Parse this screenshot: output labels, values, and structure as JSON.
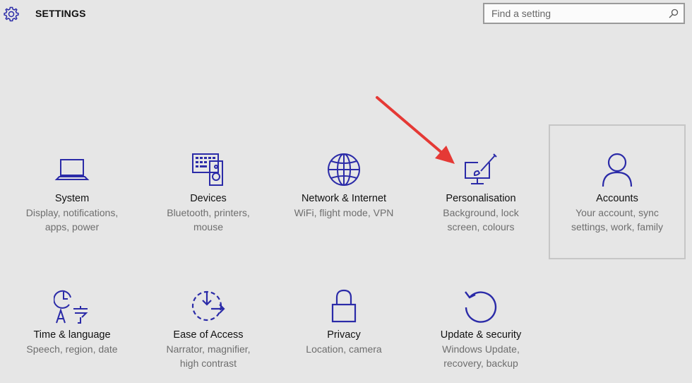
{
  "header": {
    "title": "SETTINGS",
    "search_placeholder": "Find a setting",
    "search_value": ""
  },
  "tiles": [
    {
      "name": "System",
      "desc1": "Display, notifications,",
      "desc2": "apps, power",
      "icon": "laptop-icon"
    },
    {
      "name": "Devices",
      "desc1": "Bluetooth, printers,",
      "desc2": "mouse",
      "icon": "keyboard-speaker-icon"
    },
    {
      "name": "Network & Internet",
      "desc1": "WiFi, flight mode, VPN",
      "desc2": "",
      "icon": "globe-icon"
    },
    {
      "name": "Personalisation",
      "desc1": "Background, lock",
      "desc2": "screen, colours",
      "icon": "paint-monitor-icon"
    },
    {
      "name": "Accounts",
      "desc1": "Your account, sync",
      "desc2": "settings, work, family",
      "icon": "person-icon"
    },
    {
      "name": "Time & language",
      "desc1": "Speech, region, date",
      "desc2": "",
      "icon": "time-language-icon"
    },
    {
      "name": "Ease of Access",
      "desc1": "Narrator, magnifier,",
      "desc2": "high contrast",
      "icon": "ease-of-access-icon"
    },
    {
      "name": "Privacy",
      "desc1": "Location, camera",
      "desc2": "",
      "icon": "lock-icon"
    },
    {
      "name": "Update & security",
      "desc1": "Windows Update,",
      "desc2": "recovery, backup",
      "icon": "refresh-icon"
    }
  ],
  "colors": {
    "accent": "#2b2ba8",
    "background": "#e6e6e6",
    "description": "#6e6e6e",
    "annotation_arrow": "#e53935"
  }
}
